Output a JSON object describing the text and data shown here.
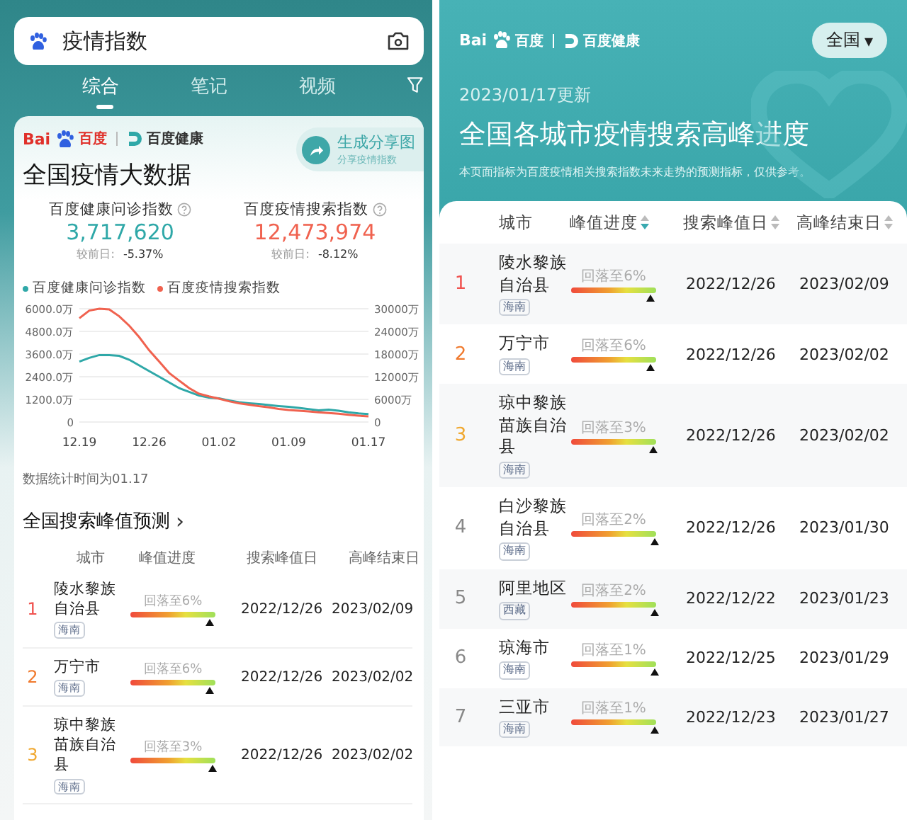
{
  "left": {
    "search": {
      "value": "疫情指数"
    },
    "tabs": [
      {
        "label": "综合",
        "selected": true
      },
      {
        "label": "笔记",
        "selected": false
      },
      {
        "label": "视频",
        "selected": false
      }
    ],
    "card": {
      "logo": {
        "bai": "Bai",
        "baidu": "百度",
        "health": "百度健康"
      },
      "share": {
        "title": "生成分享图",
        "subtitle": "分享疫情指数"
      },
      "title": "全国疫情大数据",
      "stats": [
        {
          "label": "百度健康问诊指数",
          "value": "3,717,620",
          "compare_label": "较前日:",
          "compare": "-5.37%",
          "color": "#2fa8a8"
        },
        {
          "label": "百度疫情搜索指数",
          "value": "12,473,974",
          "compare_label": "较前日:",
          "compare": "-8.12%",
          "color": "#f0624f"
        }
      ],
      "chart_data": {
        "type": "line",
        "grid": true,
        "categories": [
          "12.19",
          null,
          null,
          null,
          null,
          null,
          null,
          "12.26",
          null,
          null,
          null,
          null,
          null,
          null,
          "01.02",
          null,
          null,
          null,
          null,
          null,
          null,
          "01.09",
          null,
          null,
          null,
          null,
          null,
          null,
          null,
          "01.17"
        ],
        "ylim": [
          0,
          6000
        ],
        "yticks": [
          {
            "value": 0,
            "label": "0"
          },
          {
            "value": 1200,
            "label": "1200.0万"
          },
          {
            "value": 2400,
            "label": "2400.0万"
          },
          {
            "value": 3600,
            "label": "3600.0万"
          },
          {
            "value": 4800,
            "label": "4800.0万"
          },
          {
            "value": 6000,
            "label": "6000.0万"
          }
        ],
        "y2lim": [
          0,
          30000
        ],
        "y2ticks": [
          {
            "value": 0,
            "label": "0"
          },
          {
            "value": 6000,
            "label": "6000万"
          },
          {
            "value": 12000,
            "label": "12000万"
          },
          {
            "value": 18000,
            "label": "18000万"
          },
          {
            "value": 24000,
            "label": "24000万"
          },
          {
            "value": 30000,
            "label": "30000万"
          }
        ],
        "series": [
          {
            "name": "百度健康问诊指数",
            "color": "#2fa8a8",
            "values": [
              3200,
              3400,
              3550,
              3550,
              3500,
              3300,
              3000,
              2700,
              2400,
              2100,
              1800,
              1600,
              1400,
              1300,
              1250,
              1150,
              1050,
              1000,
              950,
              900,
              850,
              800,
              750,
              680,
              620,
              650,
              600,
              520,
              460,
              420
            ]
          },
          {
            "name": "百度疫情搜索指数",
            "color": "#f0624f",
            "axis": "y2",
            "values": [
              27500,
              29500,
              30000,
              29800,
              28000,
              25500,
              22500,
              19000,
              16000,
              13000,
              11000,
              9000,
              7500,
              6800,
              6200,
              5500,
              5000,
              4600,
              4200,
              3900,
              3500,
              3200,
              3000,
              2800,
              2600,
              2400,
              2200,
              1900,
              1700,
              1500
            ]
          }
        ]
      },
      "note": "数据统计时间为01.17"
    },
    "forecast": {
      "title": "全国搜索峰值预测",
      "chevron": "›",
      "columns": [
        "城市",
        "峰值进度",
        "搜索峰值日",
        "高峰结束日"
      ],
      "rows": [
        {
          "rank": "1",
          "color": "#f0524f",
          "city": "陵水黎族自治县",
          "province": "海南",
          "progress": "回落至6%",
          "level": 0.94,
          "peak": "2022/12/26",
          "end": "2023/02/09"
        },
        {
          "rank": "2",
          "color": "#f07a2e",
          "city": "万宁市",
          "province": "海南",
          "progress": "回落至6%",
          "level": 0.94,
          "peak": "2022/12/26",
          "end": "2023/02/02"
        },
        {
          "rank": "3",
          "color": "#f0a830",
          "city": "琼中黎族苗族自治县",
          "province": "海南",
          "progress": "回落至3%",
          "level": 0.97,
          "peak": "2022/12/26",
          "end": "2023/02/02"
        }
      ]
    }
  },
  "right": {
    "logo": {
      "bai": "Bai",
      "baidu": "百度",
      "health": "百度健康"
    },
    "region_select": {
      "value": "全国",
      "caret": "▾"
    },
    "updated": "2023/01/17更新",
    "title": "全国各城市疫情搜索高峰进度",
    "subtitle": "本页面指标为百度疫情相关搜索指数未来走势的预测指标，仅供参考。",
    "columns": [
      {
        "label": "城市",
        "sortable": false
      },
      {
        "label": "峰值进度",
        "sortable": true,
        "sorted": true
      },
      {
        "label": "搜索峰值日",
        "sortable": true,
        "sorted": false
      },
      {
        "label": "高峰结束日",
        "sortable": true,
        "sorted": false
      }
    ],
    "rows": [
      {
        "rank": "1",
        "color": "#f0524f",
        "city": "陵水黎族自治县",
        "province": "海南",
        "progress": "回落至6%",
        "level": 0.94,
        "peak": "2022/12/26",
        "end": "2023/02/09"
      },
      {
        "rank": "2",
        "color": "#f07a2e",
        "city": "万宁市",
        "province": "海南",
        "progress": "回落至6%",
        "level": 0.94,
        "peak": "2022/12/26",
        "end": "2023/02/02"
      },
      {
        "rank": "3",
        "color": "#f0a830",
        "city": "琼中黎族苗族自治县",
        "province": "海南",
        "progress": "回落至3%",
        "level": 0.97,
        "peak": "2022/12/26",
        "end": "2023/02/02"
      },
      {
        "rank": "4",
        "color": "#888888",
        "city": "白沙黎族自治县",
        "province": "海南",
        "progress": "回落至2%",
        "level": 0.98,
        "peak": "2022/12/26",
        "end": "2023/01/30"
      },
      {
        "rank": "5",
        "color": "#888888",
        "city": "阿里地区",
        "province": "西藏",
        "progress": "回落至2%",
        "level": 0.98,
        "peak": "2022/12/22",
        "end": "2023/01/23"
      },
      {
        "rank": "6",
        "color": "#888888",
        "city": "琼海市",
        "province": "海南",
        "progress": "回落至1%",
        "level": 0.99,
        "peak": "2022/12/25",
        "end": "2023/01/29"
      },
      {
        "rank": "7",
        "color": "#888888",
        "city": "三亚市",
        "province": "海南",
        "progress": "回落至1%",
        "level": 0.99,
        "peak": "2022/12/23",
        "end": "2023/01/27"
      }
    ]
  }
}
